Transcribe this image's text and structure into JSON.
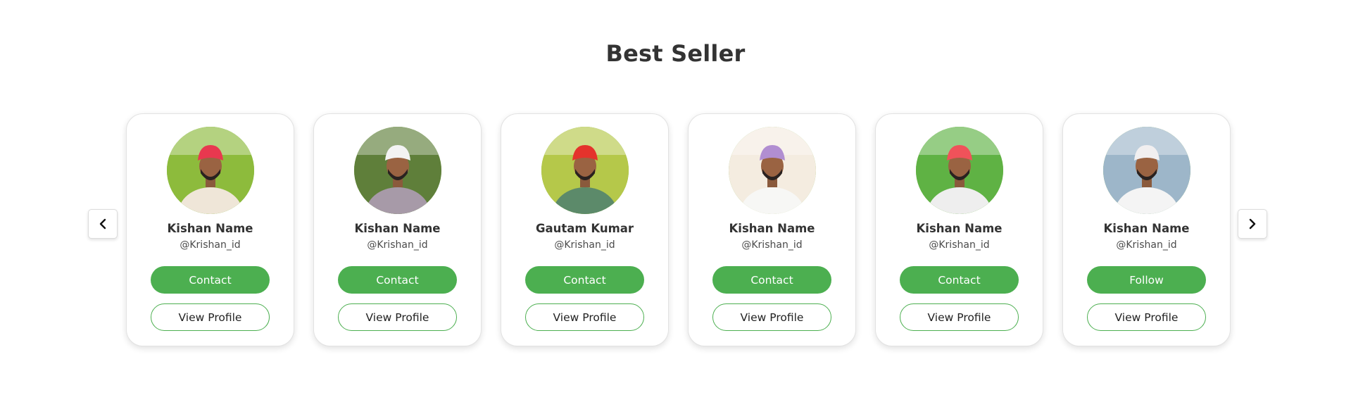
{
  "section": {
    "title": "Best Seller"
  },
  "colors": {
    "accent": "#4caf50",
    "title": "#333333",
    "card_border": "#e2e2e2"
  },
  "nav": {
    "prev_icon": "chevron-left-icon",
    "next_icon": "chevron-right-icon"
  },
  "cards": [
    {
      "name": "Kishan Name",
      "handle": "@Krishan_id",
      "primary_label": "Contact",
      "secondary_label": "View Profile",
      "turban": "#e8384f",
      "bg": "#8dbb3c",
      "shirt": "#efe6d8"
    },
    {
      "name": "Kishan Name",
      "handle": "@Krishan_id",
      "primary_label": "Contact",
      "secondary_label": "View Profile",
      "turban": "#f3f3f3",
      "bg": "#5f7f3a",
      "shirt": "#a79aa8"
    },
    {
      "name": "Gautam Kumar",
      "handle": "@Krishan_id",
      "primary_label": "Contact",
      "secondary_label": "View Profile",
      "turban": "#e4332c",
      "bg": "#b5c84a",
      "shirt": "#5c8a6a"
    },
    {
      "name": "Kishan Name",
      "handle": "@Krishan_id",
      "primary_label": "Contact",
      "secondary_label": "View Profile",
      "turban": "#b18ed1",
      "bg": "#f4ece0",
      "shirt": "#f7f7f5"
    },
    {
      "name": "Kishan Name",
      "handle": "@Krishan_id",
      "primary_label": "Contact",
      "secondary_label": "View Profile",
      "turban": "#f0525a",
      "bg": "#5fb244",
      "shirt": "#eeeeee"
    },
    {
      "name": "Kishan Name",
      "handle": "@Krishan_id",
      "primary_label": "Follow",
      "secondary_label": "View Profile",
      "turban": "#f1eff0",
      "bg": "#9db6c9",
      "shirt": "#f4f4f4"
    }
  ]
}
